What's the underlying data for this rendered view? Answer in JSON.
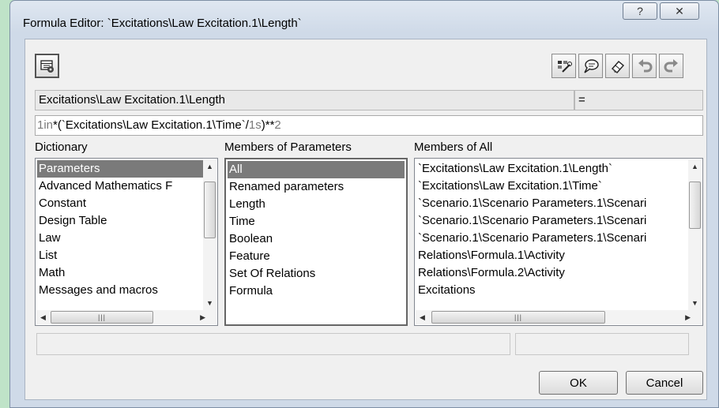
{
  "window": {
    "title": "Formula Editor: `Excitations\\Law Excitation.1\\Length`",
    "help_label": "?",
    "close_label": "✕"
  },
  "toolbar": {
    "left_icon": "formula-settings-icon",
    "right_icons": [
      "wizard-icon",
      "comment-icon",
      "eraser-icon",
      "undo-icon",
      "redo-icon"
    ]
  },
  "parameter": {
    "name": "Excitations\\Law Excitation.1\\Length",
    "equals": "="
  },
  "formula": {
    "parts": [
      {
        "text": "1in",
        "style": "gray"
      },
      {
        "text": "*(`Excitations\\Law Excitation.1\\Time`",
        "style": "normal"
      },
      {
        "text": "/",
        "style": "normal"
      },
      {
        "text": "1s",
        "style": "gray"
      },
      {
        "text": ")**",
        "style": "normal"
      },
      {
        "text": "2",
        "style": "gray"
      }
    ]
  },
  "dictionary": {
    "header": "Dictionary",
    "items": [
      "Parameters",
      "Advanced Mathematics F",
      "Constant",
      "Design Table",
      "Law",
      "List",
      "Math",
      "Messages and macros"
    ],
    "selected": 0
  },
  "members_params": {
    "header": "Members of Parameters",
    "items": [
      "All",
      "Renamed parameters",
      "Length",
      "Time",
      "Boolean",
      "Feature",
      "Set Of Relations",
      "Formula"
    ],
    "selected": 0
  },
  "members_all": {
    "header": "Members of All",
    "items": [
      "`Excitations\\Law Excitation.1\\Length`",
      "`Excitations\\Law Excitation.1\\Time`",
      "`Scenario.1\\Scenario Parameters.1\\Scenari",
      "`Scenario.1\\Scenario Parameters.1\\Scenari",
      "`Scenario.1\\Scenario Parameters.1\\Scenari",
      "Relations\\Formula.1\\Activity",
      "Relations\\Formula.2\\Activity",
      "Excitations"
    ]
  },
  "buttons": {
    "ok": "OK",
    "cancel": "Cancel"
  }
}
